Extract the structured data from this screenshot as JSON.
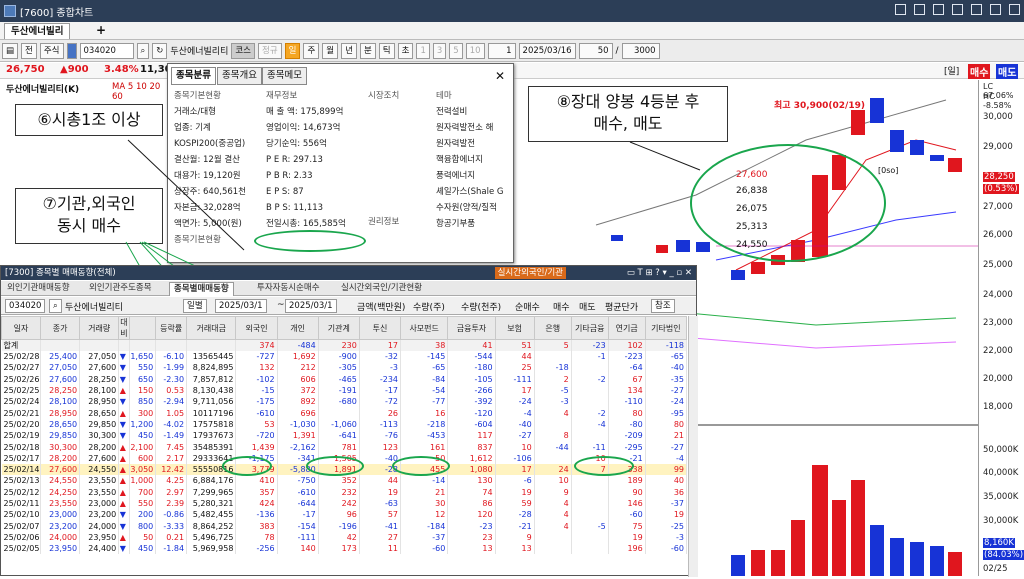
{
  "window": {
    "title": "[7600] 종합차트",
    "tab": "두산에너빌리"
  },
  "toolbar": {
    "chart_btn": "전",
    "stock_btn": "주식",
    "code": "034020",
    "name": "두산에너빌리티",
    "name_badge": "코스",
    "prefix_btn": "정규",
    "periods": [
      "일",
      "주",
      "월",
      "년",
      "분",
      "틱",
      "초"
    ],
    "mins": [
      "1",
      "3",
      "5",
      "10"
    ],
    "count_sel": "1",
    "date": "2025/03/16",
    "scale": "50",
    "bars": "3000"
  },
  "price": {
    "last": "26,750",
    "change": "▲900",
    "pct": "3.48%",
    "other": "11,30"
  },
  "chart": {
    "header": "두산에너빌리티(K)",
    "ma_label": "MA 5 10 20 60",
    "top_btns": [
      "[일]",
      "매수",
      "매도"
    ],
    "high_label": "최고 30,900(02/19)",
    "price_labels": [
      "27,600",
      "26,838",
      "26,075",
      "25,313",
      "24,550"
    ],
    "lc": "LC 67.06%",
    "hc": "HC -8.58%",
    "current": "28,250",
    "current_pct": "(0.53%)",
    "small_lbl": "[0so]",
    "axis": [
      "30,000",
      "29,000",
      "28,000",
      "27,000",
      "26,000",
      "25,000",
      "24,000",
      "23,000",
      "22,000",
      "21,000",
      "20,000",
      "19,000",
      "18,000"
    ],
    "vol_axis": [
      "50,000K",
      "45,000K",
      "40,000K",
      "35,000K",
      "30,000K",
      "25,000K",
      "20,000K"
    ],
    "vol_current": "8,160K",
    "vol_pct": "(84.03%)",
    "date_lbl": "02/25"
  },
  "popup": {
    "tabs": [
      "종목분류",
      "종목개요",
      "종목메모"
    ],
    "sec1": "종목기본현황",
    "sec1_items": [
      "거래소/대형",
      "업종: 기계",
      "KOSPI200(중공업)",
      "결산월: 12월 결산",
      "대용가: 19,120원",
      "상장주: 640,561천",
      "자본금: 32,028억",
      "액면가: 5,000(원)"
    ],
    "sec2": "재무정보",
    "sec2_items": [
      "매 출 액: 175,899억",
      "영업이익: 14,673억",
      "당기순익: 556억",
      "P E R: 297.13",
      "P B R: 2.33",
      "E P S: 87",
      "B P S: 11,113",
      "전일시총: 165,585억"
    ],
    "sec3": "시장조치",
    "sec4": "권리정보",
    "sec5": "테마",
    "themes": [
      "전력설비",
      "원자력발전소 해",
      "원자력발전",
      "핵융합에너지",
      "풍력에너지",
      "셰일가스(Shale G",
      "수자원(양적/질적",
      "항공기부품"
    ],
    "next": "종목기본현황"
  },
  "callouts": {
    "c6": "⑥시총1조 이상",
    "c7": [
      "⑦기관,외국인",
      "동시 매수"
    ],
    "c8": [
      "⑧장대 양봉 4등분 후",
      "매수, 매도"
    ]
  },
  "win2": {
    "title": "[7300] 종목별 매매동향(전체)",
    "orange_btn": "실시간외국인/기관",
    "tabs": [
      "외인기관매매동향",
      "외인기관주도종목",
      "종목별매매동향",
      "투자자동시순매수",
      "실시간외국인/기관현황"
    ],
    "code": "034020",
    "name": "두산에너빌리티",
    "period": "일별",
    "date1": "2025/03/1",
    "date2": "2025/03/1",
    "opt_a": "금액(백만원)",
    "opt_b": "수량(주)",
    "opt_c": "수량(천주)",
    "opt_d": "순매수",
    "opt_e": "매수",
    "opt_f": "매도",
    "avg": "평균단가",
    "btn1": "참조",
    "btn2": "조회",
    "headers": [
      "일자",
      "종가",
      "거래량",
      "대비",
      "등락률",
      "거래대금",
      "외국인",
      "개인",
      "기관계",
      "투신",
      "사모펀드",
      "금융투자",
      "보험",
      "은행",
      "기타금융",
      "연기금",
      "기타법인",
      "내외국인"
    ],
    "sum": [
      "합계",
      "",
      "",
      "",
      "",
      "",
      "374",
      "-484",
      "230",
      "17",
      "38",
      "41",
      "51",
      "5",
      "-23",
      "102",
      "-118",
      "-2"
    ],
    "rows": [
      [
        "25/02/28",
        "25,400",
        "27,050",
        "▼",
        "1,650",
        "-6.10",
        "13565445",
        "-727",
        "1,692",
        "-900",
        "-32",
        "-145",
        "-544",
        "44",
        "",
        "-1",
        "-223",
        "-65"
      ],
      [
        "25/02/27",
        "27,050",
        "27,600",
        "▼",
        "550",
        "-1.99",
        "8,824,895",
        "132",
        "212",
        "-305",
        "-3",
        "-65",
        "-180",
        "25",
        "-18",
        "",
        "-64",
        "-40"
      ],
      [
        "25/02/26",
        "27,600",
        "28,250",
        "▼",
        "650",
        "-2.30",
        "7,857,812",
        "-102",
        "606",
        "-465",
        "-234",
        "-84",
        "-105",
        "-111",
        "2",
        "-2",
        "67",
        "-35"
      ],
      [
        "25/02/25",
        "28,250",
        "28,100",
        "▲",
        "150",
        "0.53",
        "8,130,438",
        "-15",
        "372",
        "-191",
        "-17",
        "-54",
        "-266",
        "17",
        "-5",
        "",
        "134",
        "-27"
      ],
      [
        "25/02/24",
        "28,100",
        "28,950",
        "▼",
        "850",
        "-2.94",
        "9,711,056",
        "-175",
        "892",
        "-680",
        "-72",
        "-77",
        "-392",
        "-24",
        "-3",
        "",
        "-110",
        "-24"
      ],
      [
        "25/02/21",
        "28,950",
        "28,650",
        "▲",
        "300",
        "1.05",
        "10117196",
        "-610",
        "696",
        "",
        "26",
        "16",
        "-120",
        "-4",
        "4",
        "-2",
        "80",
        "-95"
      ],
      [
        "25/02/20",
        "28,650",
        "29,850",
        "▼",
        "1,200",
        "-4.02",
        "17575818",
        "53",
        "-1,030",
        "-1,060",
        "-113",
        "-218",
        "-604",
        "-40",
        "",
        "-4",
        "-80",
        "80"
      ],
      [
        "25/02/19",
        "29,850",
        "30,300",
        "▼",
        "450",
        "-1.49",
        "17937673",
        "-720",
        "1,391",
        "-641",
        "-76",
        "-453",
        "117",
        "-27",
        "8",
        "",
        "-209",
        "21"
      ],
      [
        "25/02/18",
        "30,300",
        "28,200",
        "▲",
        "2,100",
        "7.45",
        "35485391",
        "1,439",
        "-2,162",
        "781",
        "123",
        "161",
        "837",
        "10",
        "-44",
        "-11",
        "-295",
        "-27"
      ],
      [
        "25/02/17",
        "28,200",
        "27,600",
        "▲",
        "600",
        "2.17",
        "29333641",
        "-1,175",
        "-341",
        "1,505",
        "-40",
        "50",
        "1,612",
        "-106",
        "",
        "10",
        "-21",
        "-4"
      ],
      [
        "25/02/14",
        "27,600",
        "24,550",
        "▲",
        "3,050",
        "12.42",
        "55550816",
        "3,779",
        "-5,880",
        "1,891",
        "-28",
        "455",
        "1,080",
        "17",
        "24",
        "7",
        "338",
        "99"
      ],
      [
        "25/02/13",
        "24,550",
        "23,550",
        "▲",
        "1,000",
        "4.25",
        "6,884,176",
        "410",
        "-750",
        "352",
        "44",
        "-14",
        "130",
        "-6",
        "10",
        "",
        "189",
        "40"
      ],
      [
        "25/02/12",
        "24,250",
        "23,550",
        "▲",
        "700",
        "2.97",
        "7,299,965",
        "357",
        "-610",
        "232",
        "19",
        "21",
        "74",
        "19",
        "9",
        "",
        "90",
        "36"
      ],
      [
        "25/02/11",
        "23,550",
        "23,000",
        "▲",
        "550",
        "2.39",
        "5,280,321",
        "424",
        "-644",
        "242",
        "-63",
        "30",
        "86",
        "59",
        "4",
        "",
        "146",
        "-37"
      ],
      [
        "25/02/10",
        "23,000",
        "23,200",
        "▼",
        "200",
        "-0.86",
        "5,482,455",
        "-136",
        "-17",
        "96",
        "57",
        "12",
        "120",
        "-28",
        "4",
        "",
        "-60",
        "19"
      ],
      [
        "25/02/07",
        "23,200",
        "24,000",
        "▼",
        "800",
        "-3.33",
        "8,864,252",
        "383",
        "-154",
        "-196",
        "-41",
        "-184",
        "-23",
        "-21",
        "4",
        "-5",
        "75",
        "-25"
      ],
      [
        "25/02/06",
        "24,000",
        "23,950",
        "▲",
        "50",
        "0.21",
        "5,496,725",
        "78",
        "-111",
        "42",
        "27",
        "-37",
        "23",
        "9",
        "",
        "",
        "19",
        "-3"
      ],
      [
        "25/02/05",
        "23,950",
        "24,400",
        "▼",
        "450",
        "-1.84",
        "5,969,958",
        "-256",
        "140",
        "173",
        "11",
        "-60",
        "13",
        "13",
        "",
        "",
        "196",
        "-60"
      ]
    ]
  }
}
